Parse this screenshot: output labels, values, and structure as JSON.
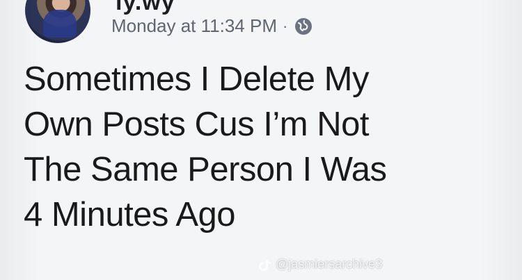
{
  "post": {
    "author_name": "ly.wy",
    "timestamp": "Monday at 11:34 PM",
    "separator": "·",
    "privacy_icon": "globe-icon",
    "text": "Sometimes I Delete My\nOwn Posts Cus I’m Not\nThe Same Person I Was\n4 Minutes Ago"
  },
  "watermark": {
    "icon": "tiktok-icon",
    "handle": "@jasmiersarchive3"
  },
  "colors": {
    "background": "#f4f5f7",
    "text": "#1a1a1a",
    "meta_text": "#5f6670"
  }
}
